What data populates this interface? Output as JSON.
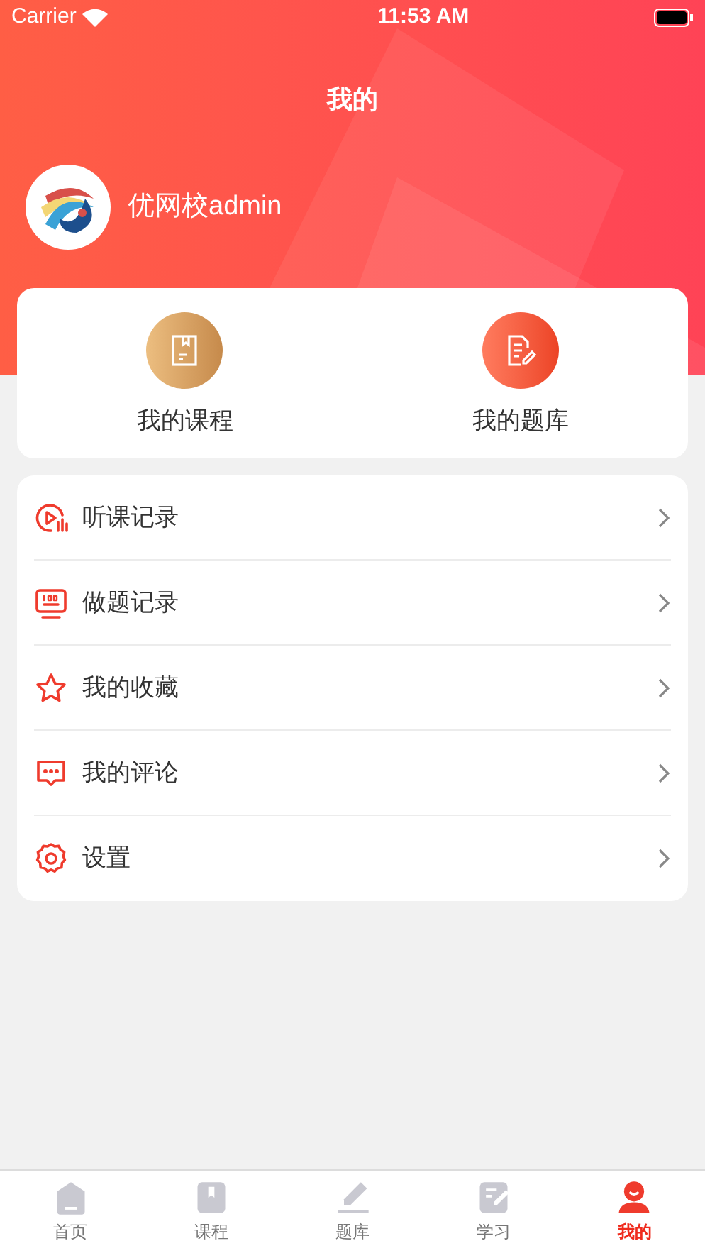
{
  "status_bar": {
    "carrier": "Carrier",
    "time": "11:53 AM"
  },
  "header": {
    "title": "我的",
    "username": "优网校admin"
  },
  "shortcuts": [
    {
      "kind": "course",
      "label": "我的课程"
    },
    {
      "kind": "bank",
      "label": "我的题库"
    }
  ],
  "menu": [
    {
      "kind": "play",
      "label": "听课记录"
    },
    {
      "kind": "score",
      "label": "做题记录"
    },
    {
      "kind": "star",
      "label": "我的收藏"
    },
    {
      "kind": "comment",
      "label": "我的评论"
    },
    {
      "kind": "gear",
      "label": "设置"
    }
  ],
  "tab_bar": [
    {
      "kind": "home",
      "label": "首页",
      "selected": false
    },
    {
      "kind": "course",
      "label": "课程",
      "selected": false
    },
    {
      "kind": "pen",
      "label": "题库",
      "selected": false
    },
    {
      "kind": "note",
      "label": "学习",
      "selected": false
    },
    {
      "kind": "user",
      "label": "我的",
      "selected": true
    }
  ]
}
